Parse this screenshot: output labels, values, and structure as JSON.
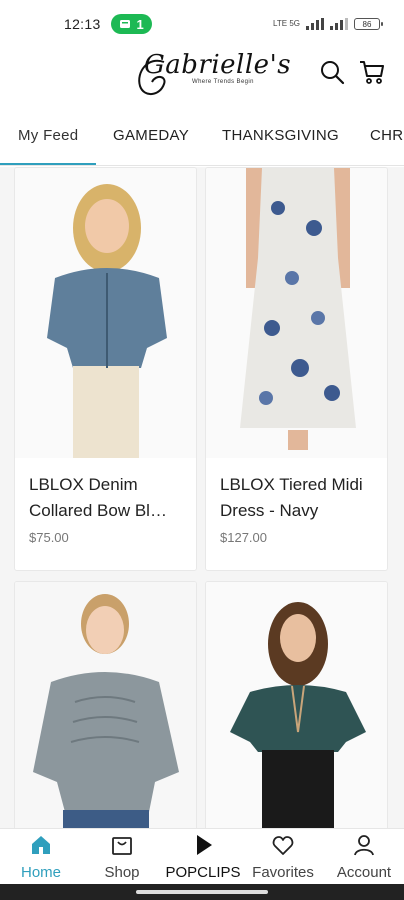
{
  "status_bar": {
    "time": "12:13",
    "call_badge": "1",
    "signal_text": "LTE 5G",
    "battery": "86"
  },
  "header": {
    "logo_text": "Gabrielle's",
    "logo_tagline": "Where Trends Begin"
  },
  "tabs": [
    {
      "label": "My Feed"
    },
    {
      "label": "GAMEDAY"
    },
    {
      "label": "THANKSGIVING"
    },
    {
      "label": "CHRI"
    }
  ],
  "products": [
    {
      "title": "LBLOX Denim Collared Bow Bl…",
      "price": "$75.00",
      "top_color": "#5f7f9b",
      "bottom_color": "#ede3cf",
      "hair_color": "#d8b36a"
    },
    {
      "title": "LBLOX Tiered Midi Dress - Navy",
      "price": "$127.00",
      "top_color": "#e9e8e4",
      "bottom_color": "#e9e8e4",
      "hair_color": "#9b7a5a"
    },
    {
      "title": "",
      "price": "",
      "top_color": "#8c979d",
      "bottom_color": "#3d5c86",
      "hair_color": "#c9a06a"
    },
    {
      "title": "",
      "price": "",
      "top_color": "#2f5454",
      "bottom_color": "#1a1a1a",
      "hair_color": "#5b3a22"
    }
  ],
  "bottom_nav": [
    {
      "label": "Home"
    },
    {
      "label": "Shop"
    },
    {
      "label": "POPCLIPS"
    },
    {
      "label": "Favorites"
    },
    {
      "label": "Account"
    }
  ],
  "colors": {
    "accent": "#2f9fbd",
    "call_green": "#1db954"
  }
}
